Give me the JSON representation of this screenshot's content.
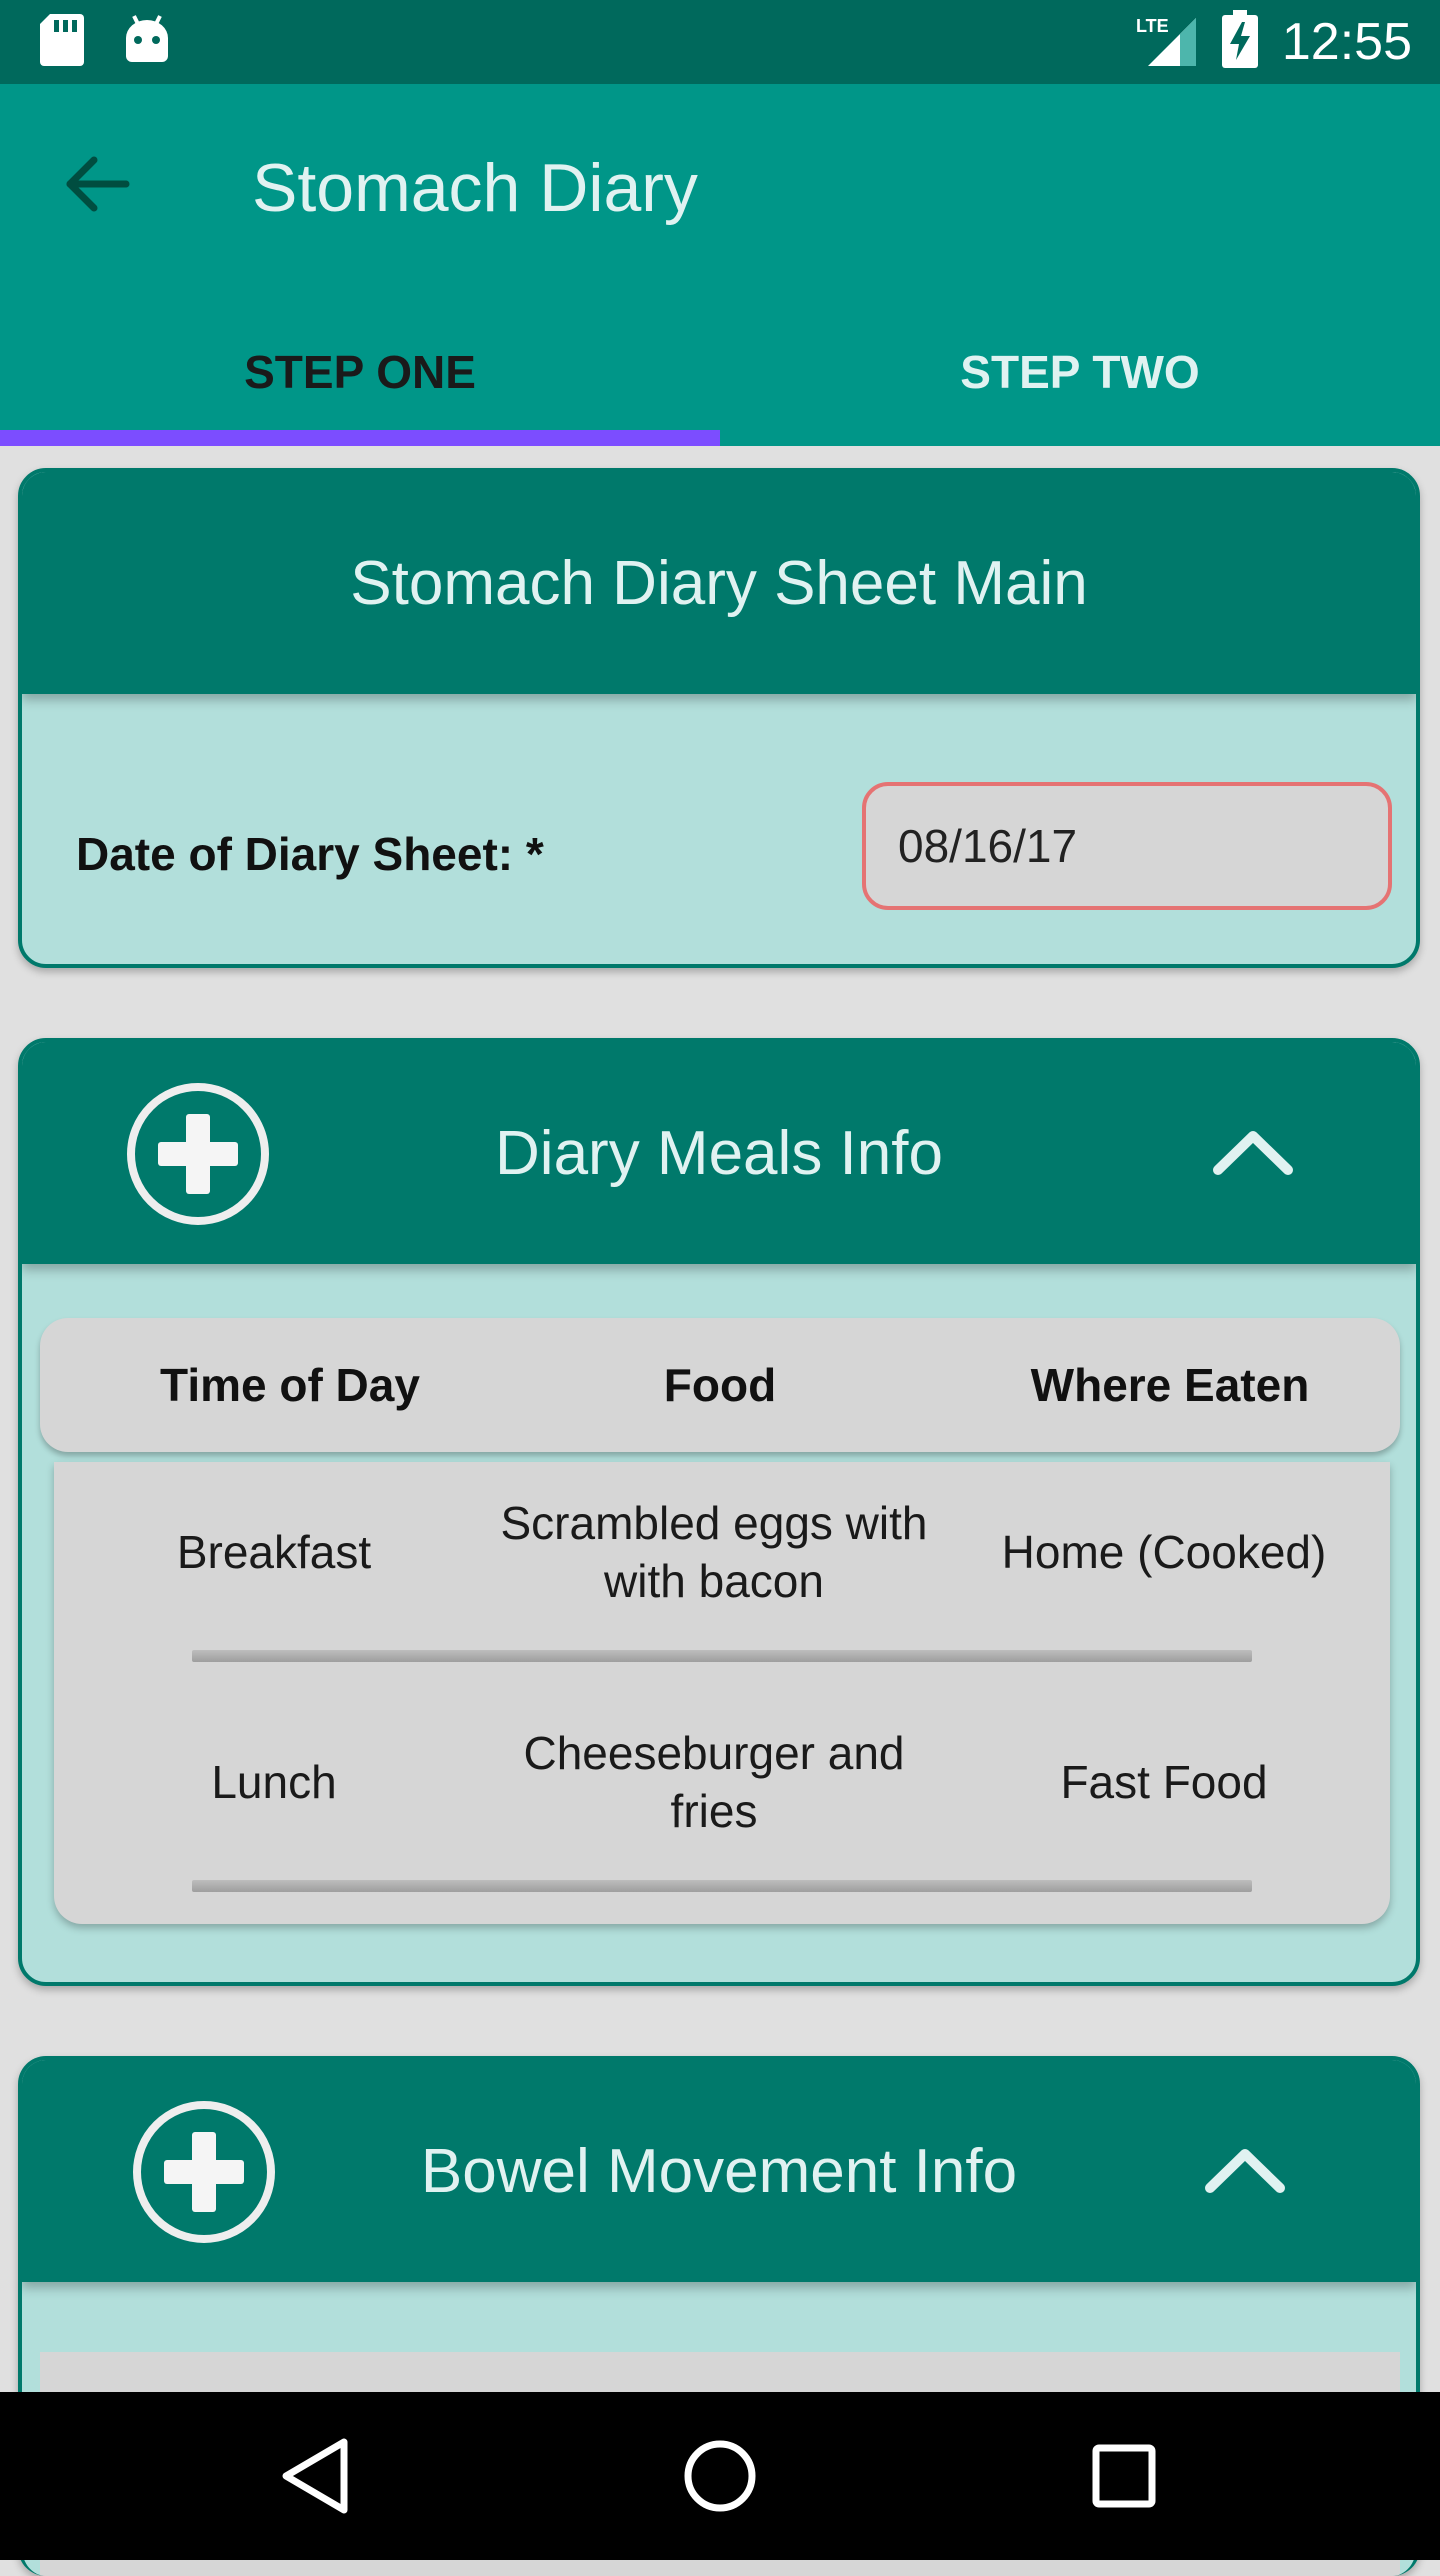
{
  "status_bar": {
    "time": "12:55",
    "network_label": "LTE",
    "icons": [
      "sd-card-icon",
      "android-icon",
      "lte-signal-icon",
      "battery-charging-icon"
    ]
  },
  "app_bar": {
    "title": "Stomach Diary",
    "back_icon": "arrow-back-icon",
    "tabs": [
      {
        "label": "STEP ONE",
        "selected": true
      },
      {
        "label": "STEP TWO",
        "selected": false
      }
    ],
    "indicator_color": "#7c4dff"
  },
  "main_sheet": {
    "title": "Stomach Diary Sheet Main",
    "date_label": "Date of Diary Sheet: *",
    "date_value": "08/16/17"
  },
  "meals": {
    "title": "Diary Meals Info",
    "add_icon": "add-circle-icon",
    "collapse_icon": "chevron-up-icon",
    "columns": [
      "Time of Day",
      "Food",
      "Where Eaten"
    ],
    "rows": [
      {
        "time": "Breakfast",
        "food": "Scrambled eggs with with bacon",
        "where": "Home (Cooked)"
      },
      {
        "time": "Lunch",
        "food": "Cheeseburger and fries",
        "where": "Fast Food"
      }
    ]
  },
  "bowel": {
    "title": "Bowel Movement Info",
    "add_icon": "add-circle-icon",
    "collapse_icon": "chevron-up-icon"
  },
  "nav_bar": {
    "icons": [
      "back-triangle-icon",
      "home-circle-icon",
      "recents-square-icon"
    ]
  },
  "colors": {
    "primary": "#009688",
    "primary_dark": "#00695c",
    "card_header": "#00796b",
    "card_body": "#b2dfdb",
    "error_outline": "#e57373"
  }
}
